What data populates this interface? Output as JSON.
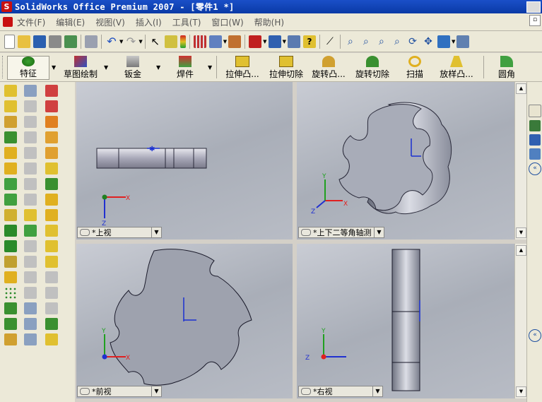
{
  "window": {
    "title": "SolidWorks Office Premium 2007 - [零件1 *]",
    "app_icon": "solidworks-icon"
  },
  "menu": {
    "items": [
      "文件(F)",
      "编辑(E)",
      "视图(V)",
      "插入(I)",
      "工具(T)",
      "窗口(W)",
      "帮助(H)"
    ]
  },
  "toolbar": {
    "icons": [
      "new-icon",
      "open-icon",
      "save-icon",
      "print-icon",
      "options-icon",
      "undo-icon",
      "redo-icon",
      "select-icon",
      "rebuild-icon",
      "zoom-fit-icon",
      "zoom-area-icon",
      "zoom-in-icon",
      "rotate-icon",
      "pan-icon",
      "view-orientation-icon"
    ]
  },
  "command_manager": {
    "tabs": [
      {
        "label": "特征",
        "icon": "feature-icon",
        "active": true
      },
      {
        "label": "草图绘制",
        "icon": "sketch-icon",
        "active": false
      },
      {
        "label": "钣金",
        "icon": "sheetmetal-icon",
        "active": false
      },
      {
        "label": "焊件",
        "icon": "weldment-icon",
        "active": false
      }
    ],
    "commands": [
      {
        "label": "拉伸凸...",
        "icon": "extrude-boss-icon"
      },
      {
        "label": "拉伸切除",
        "icon": "extrude-cut-icon"
      },
      {
        "label": "旋转凸...",
        "icon": "revolve-boss-icon"
      },
      {
        "label": "旋转切除",
        "icon": "revolve-cut-icon"
      },
      {
        "label": "扫描",
        "icon": "sweep-icon"
      },
      {
        "label": "放样凸...",
        "icon": "loft-boss-icon"
      },
      {
        "label": "圆角",
        "icon": "fillet-icon"
      }
    ]
  },
  "viewports": [
    {
      "label": "*上视",
      "view": "top"
    },
    {
      "label": "*上下二等角轴测",
      "view": "trimetric"
    },
    {
      "label": "*前视",
      "view": "front"
    },
    {
      "label": "*右视",
      "view": "right"
    }
  ],
  "triad": {
    "x": "X",
    "y": "Y",
    "z": "Z"
  },
  "colors": {
    "title_bar": "#0a3aa6",
    "viewport_bg": "#b5b9c2",
    "part_gray": "#9ea2ae",
    "axis_x": "#e02020",
    "axis_y": "#20a020",
    "axis_z": "#2030d0"
  }
}
